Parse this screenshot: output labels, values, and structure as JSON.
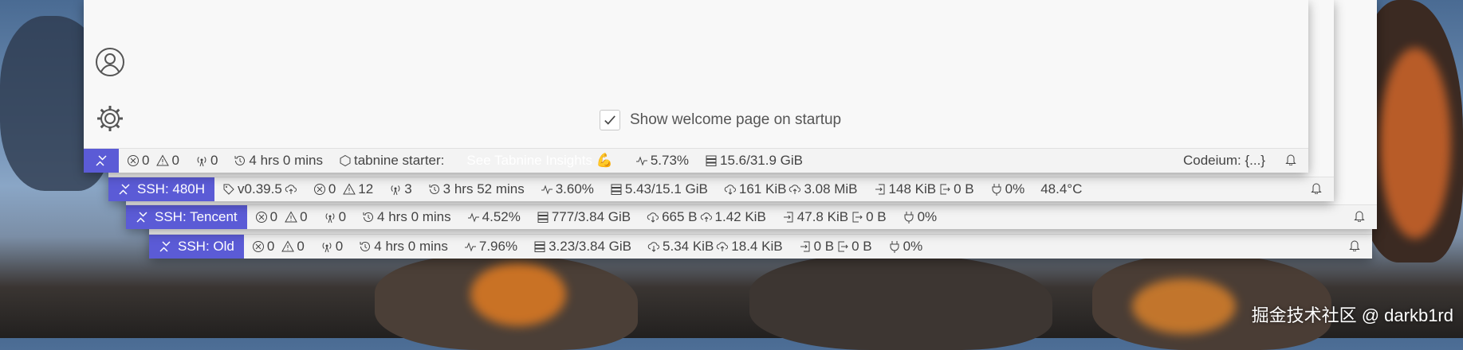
{
  "welcome": {
    "checkbox_label": "Show welcome page on startup",
    "checked": true
  },
  "windows": [
    {
      "id": "main",
      "remote_label": "",
      "items": [
        "0",
        "0",
        "0",
        "4 hrs 0 mins",
        "tabnine starter:",
        "See Tabnine Insights 💪",
        "5.73%",
        "15.6/31.9 GiB"
      ],
      "right": "Codeium: {...}"
    },
    {
      "id": "480h",
      "remote_label": "SSH: 480H",
      "version": "v0.39.5",
      "errors": "0",
      "warnings": "12",
      "ports": "3",
      "uptime": "3 hrs 52 mins",
      "cpu": "3.60%",
      "mem": "5.43/15.1 GiB",
      "down": "161 KiB",
      "up": "3.08 MiB",
      "disk_in": "148 KiB",
      "disk_out": "0 B",
      "power": "0%",
      "temp": "48.4°C"
    },
    {
      "id": "tencent",
      "remote_label": "SSH: Tencent",
      "errors": "0",
      "warnings": "0",
      "ports": "0",
      "uptime": "4 hrs 0 mins",
      "cpu": "4.52%",
      "mem": "777/3.84 GiB",
      "down": "665 B",
      "up": "1.42 KiB",
      "disk_in": "47.8 KiB",
      "disk_out": "0 B",
      "power": "0%"
    },
    {
      "id": "old",
      "remote_label": "SSH: Old",
      "errors": "0",
      "warnings": "0",
      "ports": "0",
      "uptime": "4 hrs 0 mins",
      "cpu": "7.96%",
      "mem": "3.23/3.84 GiB",
      "down": "5.34 KiB",
      "up": "18.4 KiB",
      "disk_in": "0 B",
      "disk_out": "0 B",
      "power": "0%"
    }
  ],
  "watermark": "掘金技术社区 @ darkb1rd",
  "colors": {
    "remote_bg": "#5b5bd6",
    "statusbar_bg": "#f3f3f3",
    "window_bg": "#f8f8f8"
  }
}
